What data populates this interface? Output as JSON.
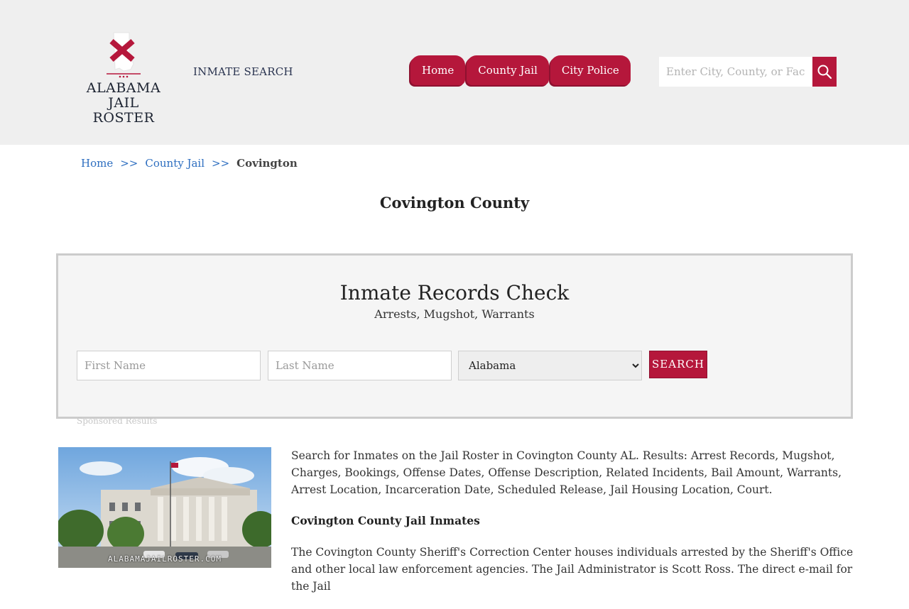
{
  "site": {
    "logo_line1": "ALABAMA",
    "logo_line2": "JAIL ROSTER",
    "inmate_search_link": "INMATE SEARCH"
  },
  "nav": {
    "items": [
      {
        "label": "Home"
      },
      {
        "label": "County Jail"
      },
      {
        "label": "City Police"
      }
    ]
  },
  "header_search": {
    "placeholder": "Enter City, County, or Facility"
  },
  "breadcrumb": {
    "home": "Home",
    "sep1": ">>",
    "county_jail": "County Jail",
    "sep2": ">>",
    "current": "Covington"
  },
  "page": {
    "title": "Covington County"
  },
  "records_check": {
    "title": "Inmate Records Check",
    "subtitle": "Arrests, Mugshot, Warrants",
    "first_name_placeholder": "First Name",
    "last_name_placeholder": "Last Name",
    "state_selected": "Alabama",
    "search_label": "SEARCH"
  },
  "sponsored_label": "Sponsored Results",
  "photo": {
    "watermark": "ALABAMAJAILROSTER.COM"
  },
  "content": {
    "intro": "Search for Inmates on the Jail Roster in Covington County AL. Results: Arrest Records, Mugshot, Charges, Bookings, Offense Dates, Offense Description, Related Incidents, Bail Amount, Warrants, Arrest Location, Incarceration Date, Scheduled Release, Jail Housing Location, Court.",
    "subheading": "Covington County Jail Inmates",
    "body": "The Covington County Sheriff's Correction Center houses individuals arrested by the Sheriff's Office and other local law enforcement agencies. The Jail Administrator is Scott Ross. The direct e-mail for the Jail"
  },
  "colors": {
    "accent": "#b5173b",
    "header_bg": "#efefef",
    "link": "#2d6ec0"
  }
}
